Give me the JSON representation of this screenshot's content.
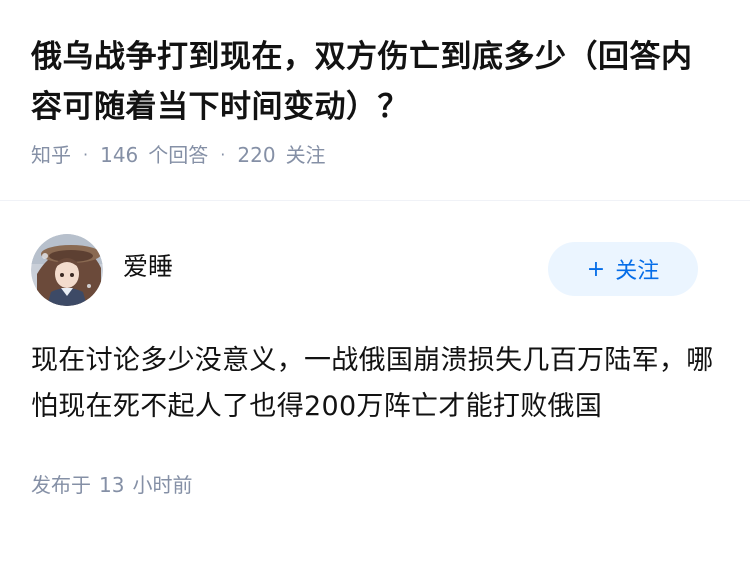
{
  "question": {
    "title": "俄乌战争打到现在，双方伤亡到底多少（回答内容可随着当下时间变动）？",
    "source": "知乎",
    "answer_count": "146",
    "answer_label": "个回答",
    "follower_count": "220",
    "follower_label": "关注"
  },
  "answer": {
    "author": {
      "name": "爱睡",
      "avatar_icon": "anime-avatar-icon"
    },
    "follow_button": {
      "icon": "plus-icon",
      "label": "关注",
      "color": "#056de8",
      "background": "#ebf5ff"
    },
    "content": "现在讨论多少没意义，一战俄国崩溃损失几百万陆军，哪怕现在死不起人了也得200万阵亡才能打败俄国",
    "time_prefix": "发布于",
    "time_value": "13",
    "time_suffix": "小时前"
  },
  "colors": {
    "title": "#121212",
    "meta": "#8590a6"
  }
}
